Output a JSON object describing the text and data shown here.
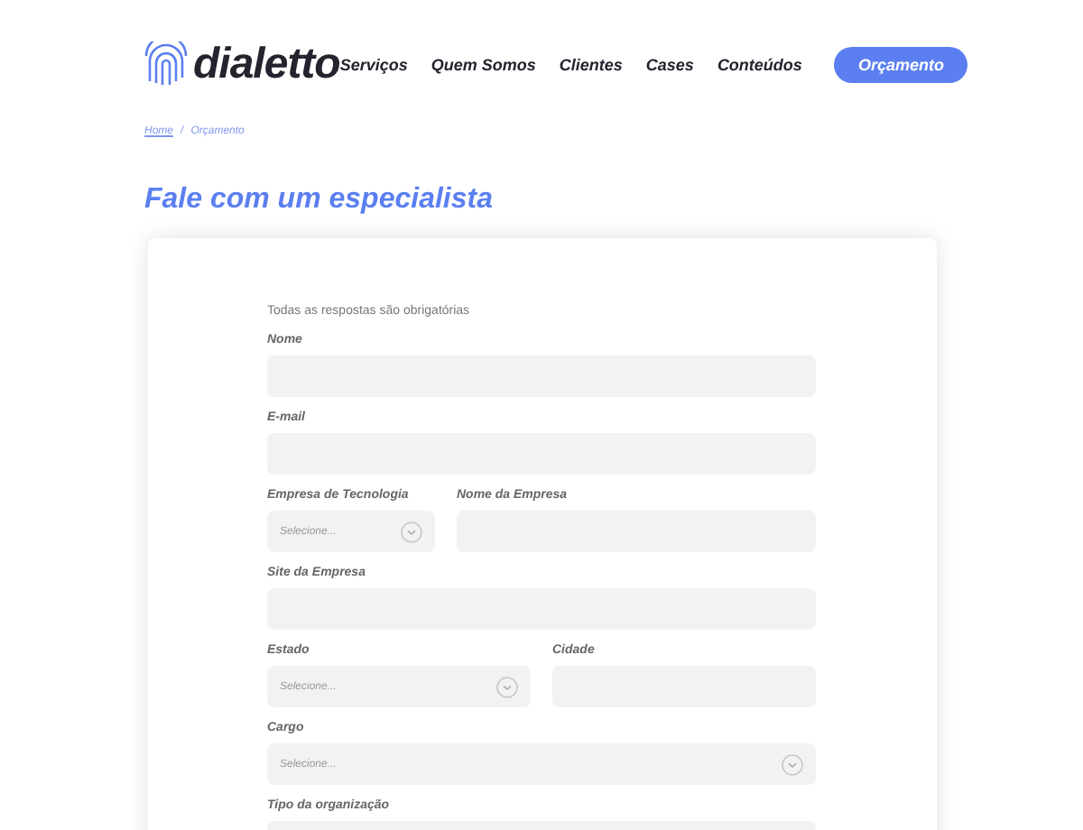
{
  "header": {
    "logo": "dialetto",
    "nav": [
      "Serviços",
      "Quem Somos",
      "Clientes",
      "Cases",
      "Conteúdos"
    ],
    "cta": "Orçamento"
  },
  "breadcrumb": [
    "Home",
    "/",
    "Orçamento"
  ],
  "title": "Fale com um especialista",
  "form": {
    "note": "Todas as respostas são obrigatórias",
    "rows": [
      [
        {
          "label": "Nome",
          "kind": "text"
        }
      ],
      [
        {
          "label": "E-mail",
          "kind": "text"
        }
      ],
      [
        {
          "label": "Empresa de Tecnologia",
          "kind": "select",
          "placeholder": "Selecione..."
        },
        {
          "label": "Nome da Empresa",
          "kind": "text"
        }
      ],
      [
        {
          "label": "Site da Empresa",
          "kind": "text"
        }
      ],
      [
        {
          "label": "Estado",
          "kind": "select",
          "placeholder": "Selecione..."
        },
        {
          "label": "Cidade",
          "kind": "text"
        }
      ],
      [
        {
          "label": "Cargo",
          "kind": "select",
          "placeholder": "Selecione..."
        }
      ],
      [
        {
          "label": "Tipo da organização",
          "kind": "text"
        }
      ]
    ]
  }
}
